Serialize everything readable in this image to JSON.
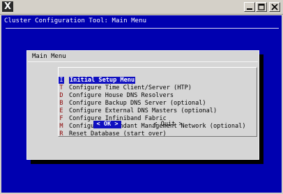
{
  "terminal": {
    "title": "Cluster Configuration Tool: Main Menu"
  },
  "dialog": {
    "title": "Main Menu",
    "items": [
      {
        "key": "I",
        "label": "Initial Setup Menu",
        "selected": true
      },
      {
        "key": "T",
        "label": "Configure Time Client/Server (HTP)"
      },
      {
        "key": "D",
        "label": "Configure House DNS Resolvers"
      },
      {
        "key": "B",
        "label": "Configure Backup DNS Server (optional)"
      },
      {
        "key": "E",
        "label": "Configure External DNS Masters (optional)"
      },
      {
        "key": "F",
        "label": "Configure Infiniband Fabric"
      },
      {
        "key": "M",
        "label": "Configure Redundant Management Network (optional)"
      },
      {
        "key": "R",
        "label": "Reset Database (start over)"
      }
    ],
    "ok_label": "< OK >",
    "quit_label": "< Quit >"
  },
  "colors": {
    "terminal_bg": "#0000b0",
    "dialog_bg": "#d6d6d6",
    "highlight": "#1010c0",
    "hotkey": "#8b0000"
  }
}
